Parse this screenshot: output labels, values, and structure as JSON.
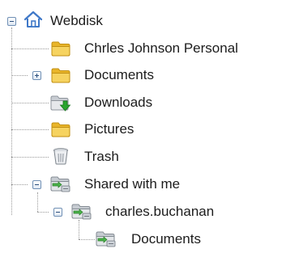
{
  "tree": {
    "root": {
      "label": "Webdisk",
      "icon": "home-icon",
      "expanded": true
    },
    "items": [
      {
        "label": "Chrles Johnson Personal",
        "icon": "folder-icon"
      },
      {
        "label": "Documents",
        "icon": "folder-icon",
        "expanded": false
      },
      {
        "label": "Downloads",
        "icon": "downloads-folder-icon"
      },
      {
        "label": "Pictures",
        "icon": "folder-icon"
      },
      {
        "label": "Trash",
        "icon": "trash-icon"
      },
      {
        "label": "Shared with me",
        "icon": "shared-folder-icon",
        "expanded": true,
        "children": [
          {
            "label": "charles.buchanan",
            "icon": "shared-folder-icon",
            "expanded": true,
            "children": [
              {
                "label": "Documents",
                "icon": "shared-folder-icon"
              }
            ]
          }
        ]
      }
    ],
    "colors": {
      "folder": "#f3c53c",
      "connector": "#9a9a9a",
      "toggle_border": "#6f8fb4",
      "home": "#3f78c8",
      "download_arrow": "#2aa52f"
    }
  }
}
